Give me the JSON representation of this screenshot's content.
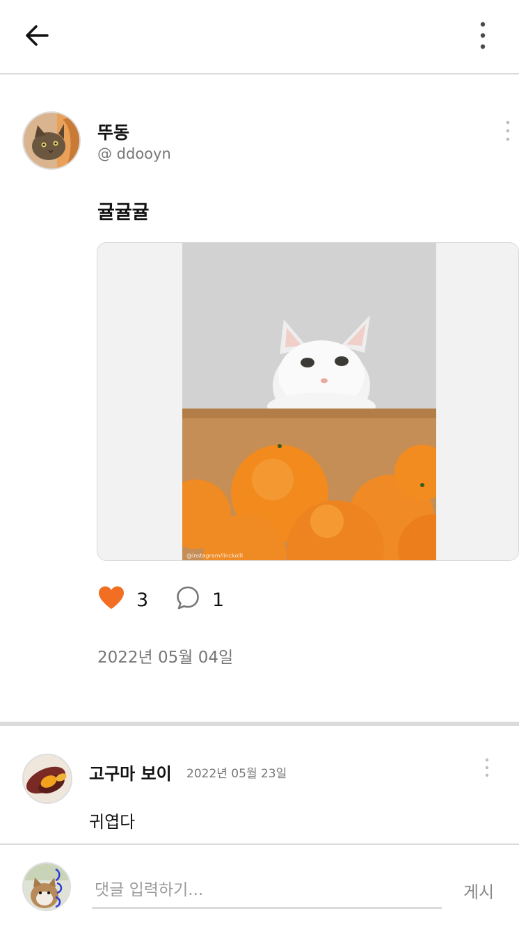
{
  "header": {
    "back_icon": "arrow-left-icon",
    "menu_icon": "more-vertical-icon"
  },
  "post": {
    "author_name": "뚜동",
    "author_handle": "@ ddooyn",
    "text": "귤귤귤",
    "image_watermark": "@instagram/linckolli",
    "like_count": "3",
    "comment_count": "1",
    "date": "2022년 05월 04일",
    "colors": {
      "heart": "#f26e22",
      "image_bg": "#f2f2f2"
    }
  },
  "comment": {
    "author_name": "고구마 보이",
    "date": "2022년 05월 23일",
    "text": "귀엽다"
  },
  "comment_input": {
    "placeholder": "댓글 입력하기...",
    "value": "",
    "submit_label": "게시"
  }
}
